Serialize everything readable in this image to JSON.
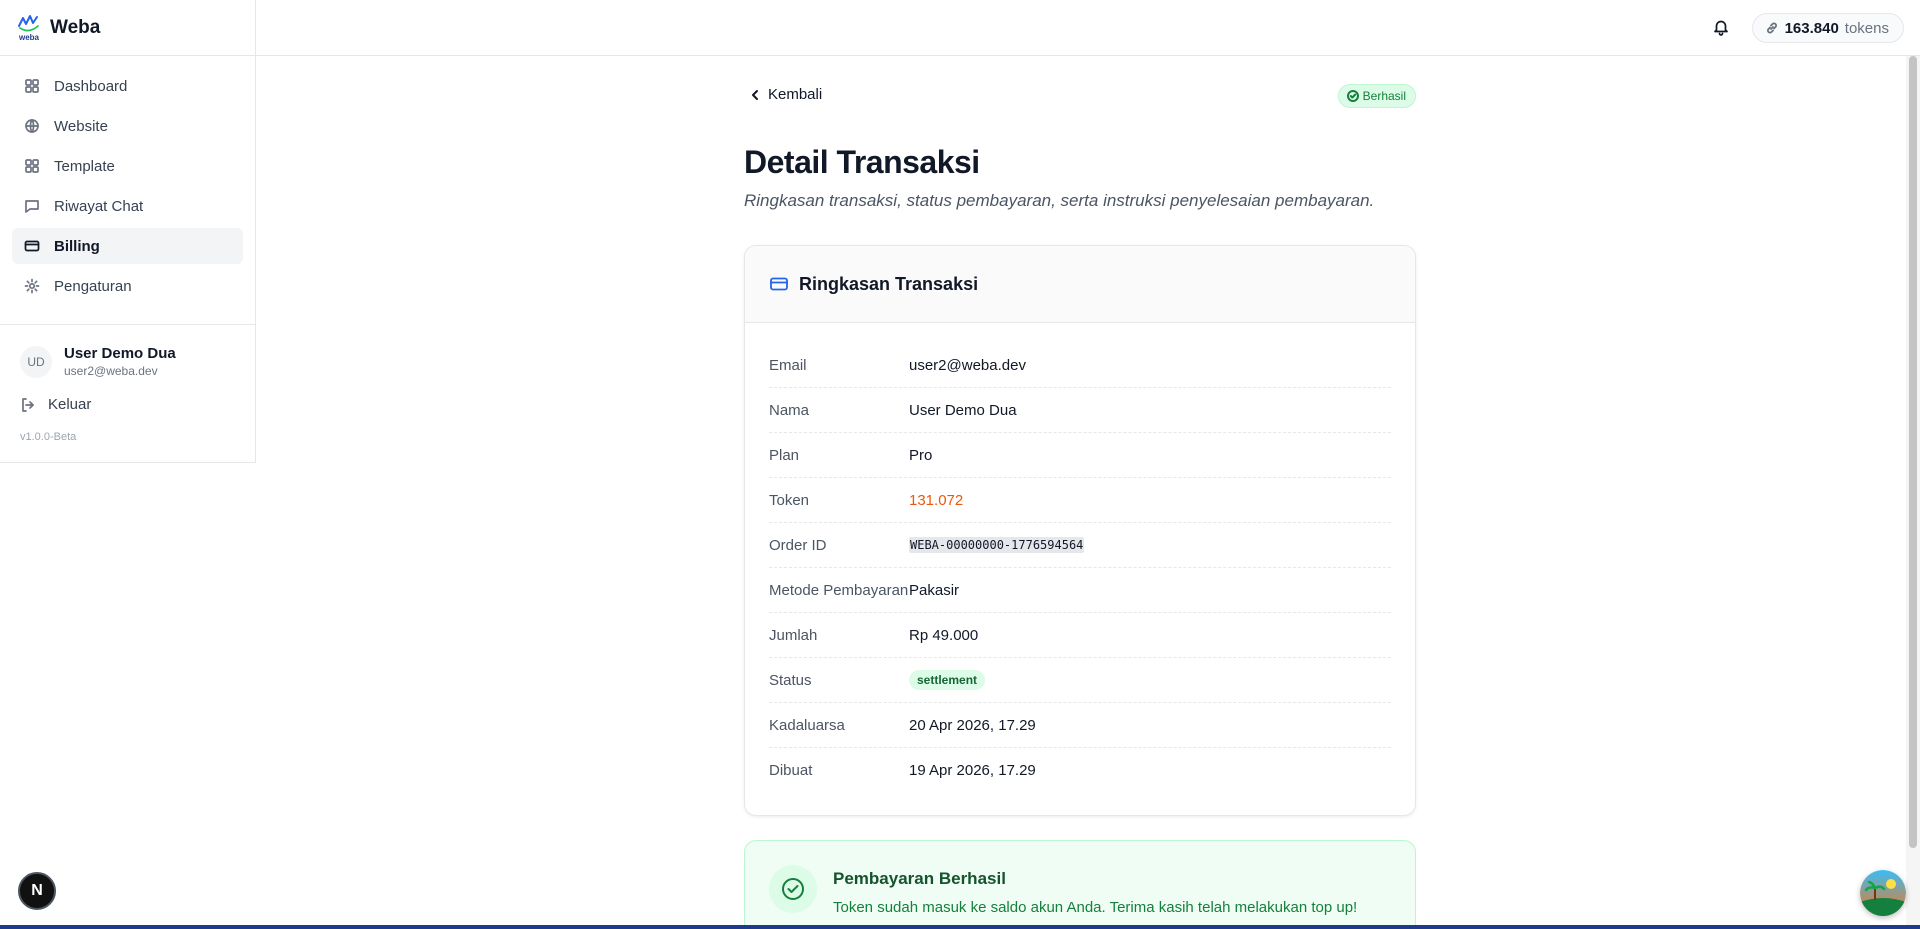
{
  "brand": {
    "name": "Weba",
    "logo_text": "weba"
  },
  "nav": [
    {
      "label": "Dashboard",
      "icon": "grid-icon"
    },
    {
      "label": "Website",
      "icon": "globe-icon"
    },
    {
      "label": "Template",
      "icon": "layout-icon"
    },
    {
      "label": "Riwayat Chat",
      "icon": "message-icon"
    },
    {
      "label": "Billing",
      "icon": "credit-card-icon",
      "active": true
    },
    {
      "label": "Pengaturan",
      "icon": "gear-icon"
    }
  ],
  "user": {
    "initials": "UD",
    "name": "User Demo Dua",
    "email": "user2@weba.dev"
  },
  "logout_label": "Keluar",
  "version": "v1.0.0-Beta",
  "topbar": {
    "token_value": "163.840",
    "token_unit": "tokens"
  },
  "page": {
    "back_label": "Kembali",
    "status_label": "Berhasil",
    "title": "Detail Transaksi",
    "subtitle": "Ringkasan transaksi, status pembayaran, serta instruksi penyelesaian pembayaran."
  },
  "summary": {
    "title": "Ringkasan Transaksi",
    "rows": [
      {
        "label": "Email",
        "value": "user2@weba.dev"
      },
      {
        "label": "Nama",
        "value": "User Demo Dua"
      },
      {
        "label": "Plan",
        "value": "Pro"
      },
      {
        "label": "Token",
        "value": "131.072"
      },
      {
        "label": "Order ID",
        "value": "WEBA-00000000-1776594564"
      },
      {
        "label": "Metode Pembayaran",
        "value": "Pakasir"
      },
      {
        "label": "Jumlah",
        "value": "Rp 49.000"
      },
      {
        "label": "Status",
        "value": "settlement"
      },
      {
        "label": "Kadaluarsa",
        "value": "20 Apr 2026, 17.29"
      },
      {
        "label": "Dibuat",
        "value": "19 Apr 2026, 17.29"
      }
    ]
  },
  "success": {
    "title": "Pembayaran Berhasil",
    "text": "Token sudah masuk ke saldo akun Anda. Terima kasih telah melakukan top up!"
  },
  "fab": {
    "label": "N"
  },
  "colors": {
    "accent": "#2563eb",
    "success": "#15803d",
    "token_orange": "#ea580c"
  }
}
